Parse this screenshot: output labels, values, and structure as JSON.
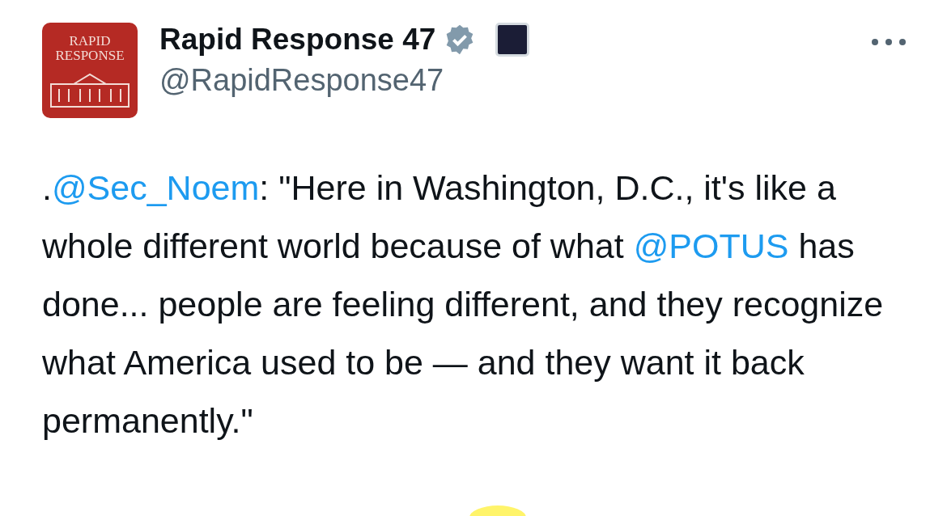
{
  "author": {
    "avatar_label": "RAPID RESPONSE",
    "name": "Rapid Response 47",
    "handle": "@RapidResponse47",
    "verified": true
  },
  "tweet": {
    "segments": [
      {
        "kind": "text",
        "text": "."
      },
      {
        "kind": "link",
        "text": "@Sec_Noem"
      },
      {
        "kind": "text",
        "text": ": \"Here in Washington, D.C., it's like a whole different world because of what "
      },
      {
        "kind": "link",
        "text": "@POTUS"
      },
      {
        "kind": "text",
        "text": " has done... people are feeling different, and they recognize what America used to be — and they want it back permanently.\""
      }
    ]
  }
}
